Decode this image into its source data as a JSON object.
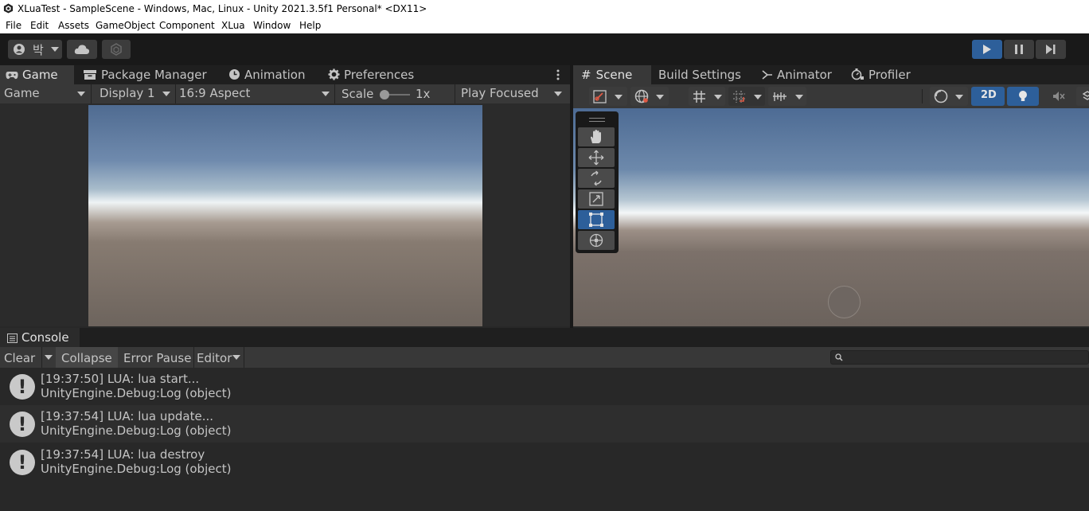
{
  "window": {
    "title": "XLuaTest - SampleScene - Windows, Mac, Linux - Unity 2021.3.5f1 Personal* <DX11>"
  },
  "menu": [
    "File",
    "Edit",
    "Assets",
    "GameObject",
    "Component",
    "XLua",
    "Window",
    "Help"
  ],
  "account": {
    "label": "박"
  },
  "left_tabs": [
    "Game",
    "Package Manager",
    "Animation",
    "Preferences"
  ],
  "game_toolbar": {
    "view": "Game",
    "display": "Display 1",
    "aspect": "16:9 Aspect",
    "scale_label": "Scale",
    "scale_value": "1x",
    "play_mode": "Play Focused"
  },
  "right_tabs": [
    "Scene",
    "Build Settings",
    "Animator",
    "Profiler"
  ],
  "scene_toolbar": {
    "mode_2d": "2D"
  },
  "console": {
    "tab": "Console",
    "clear": "Clear",
    "collapse": "Collapse",
    "error_pause": "Error Pause",
    "editor": "Editor",
    "search_placeholder": "",
    "logs": [
      {
        "line1": "[19:37:50] LUA: lua start...",
        "line2": "UnityEngine.Debug:Log (object)"
      },
      {
        "line1": "[19:37:54] LUA: lua update...",
        "line2": "UnityEngine.Debug:Log (object)"
      },
      {
        "line1": "[19:37:54] LUA: lua destroy",
        "line2": "UnityEngine.Debug:Log (object)"
      }
    ]
  },
  "colors": {
    "accent": "#2d5f9a",
    "panel": "#383838",
    "background": "#282828",
    "log_alt_row": "#2e2e2e"
  }
}
